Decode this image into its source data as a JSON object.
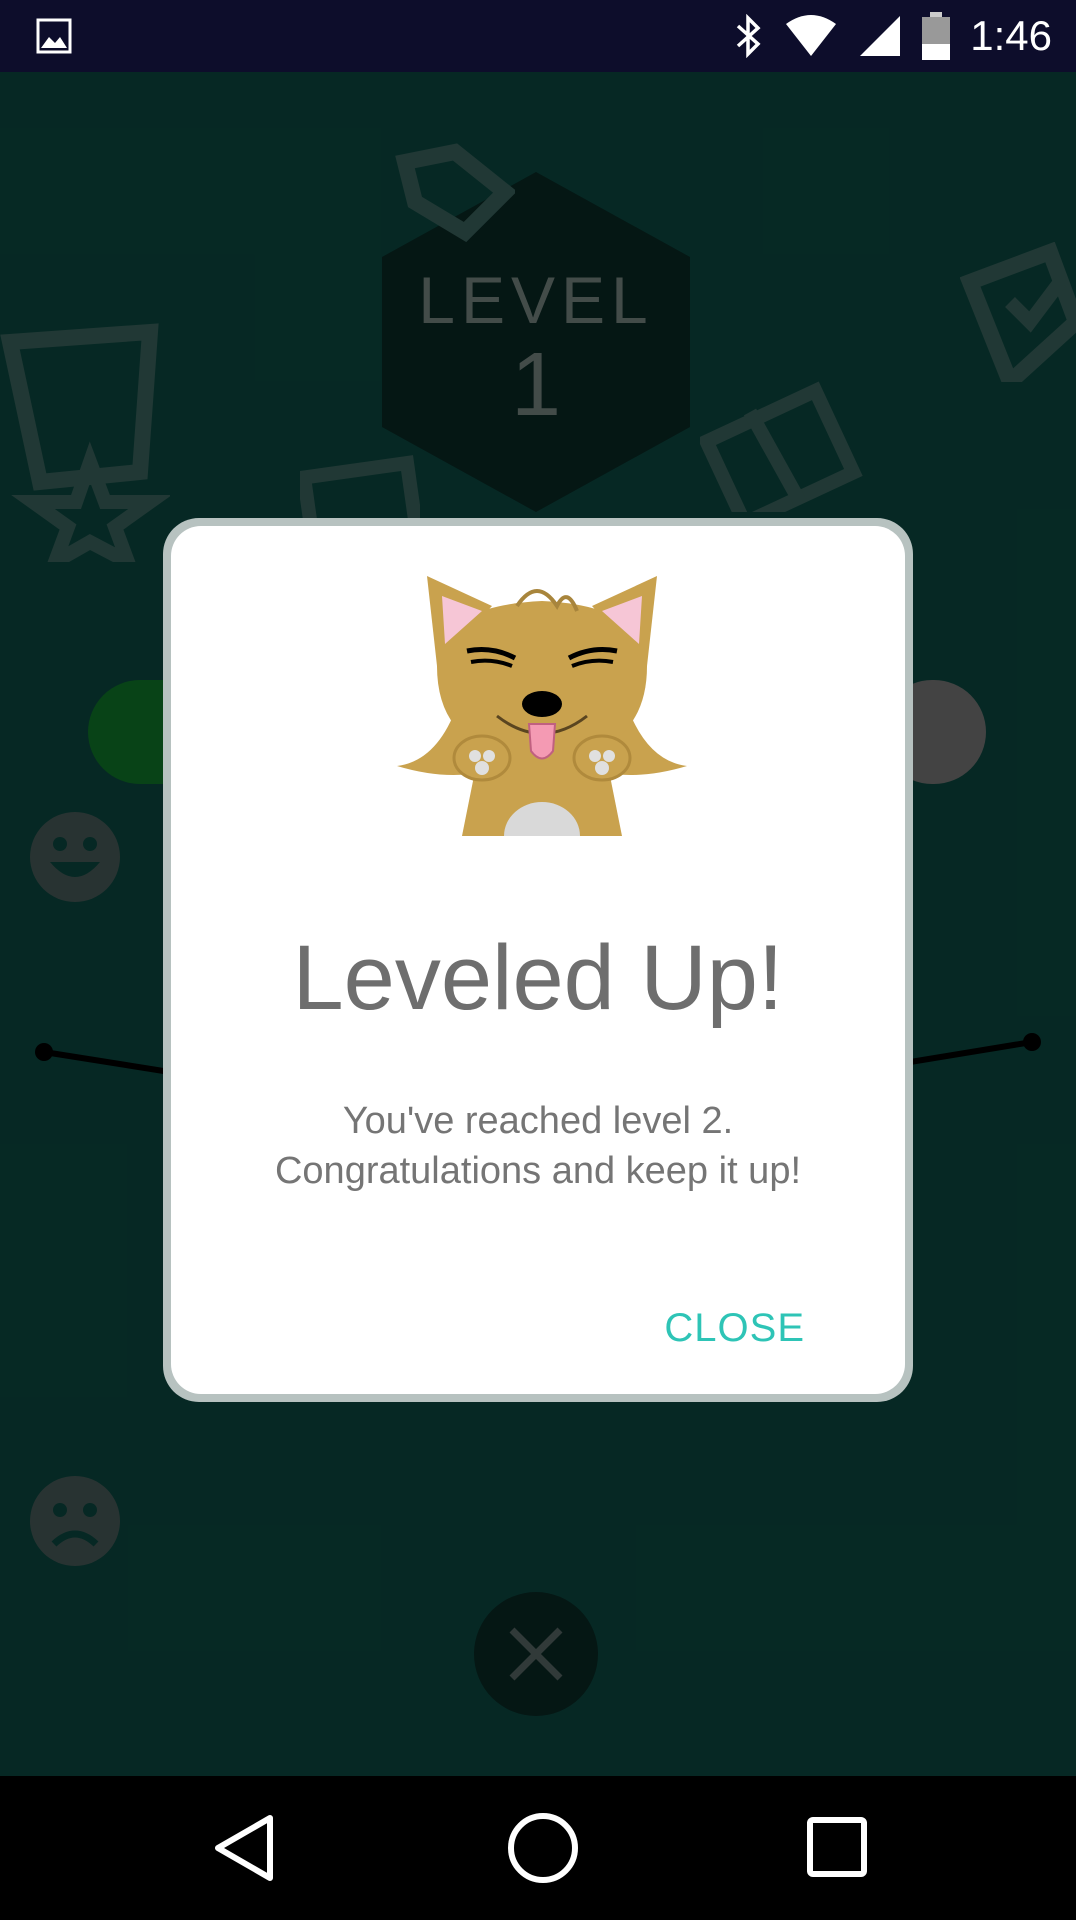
{
  "status_bar": {
    "time": "1:46",
    "icons": [
      "gallery-icon",
      "bluetooth-icon",
      "wifi-icon",
      "signal-icon",
      "battery-icon"
    ]
  },
  "background": {
    "level_word": "LEVEL",
    "level_number": "1",
    "colors": {
      "bg": "#0b4a42",
      "left_pill": "#0f7a2a",
      "right_pill": "#7a7a7a"
    }
  },
  "dialog": {
    "title": "Leveled Up!",
    "message_line1": "You've reached level 2.",
    "message_line2": "Congratulations and keep it up!",
    "close_label": "CLOSE",
    "mascot": "dog-mascot-icon",
    "accent_color": "#2ec4b6"
  },
  "nav_bar": {
    "icons": [
      "back-icon",
      "home-icon",
      "recents-icon"
    ]
  }
}
